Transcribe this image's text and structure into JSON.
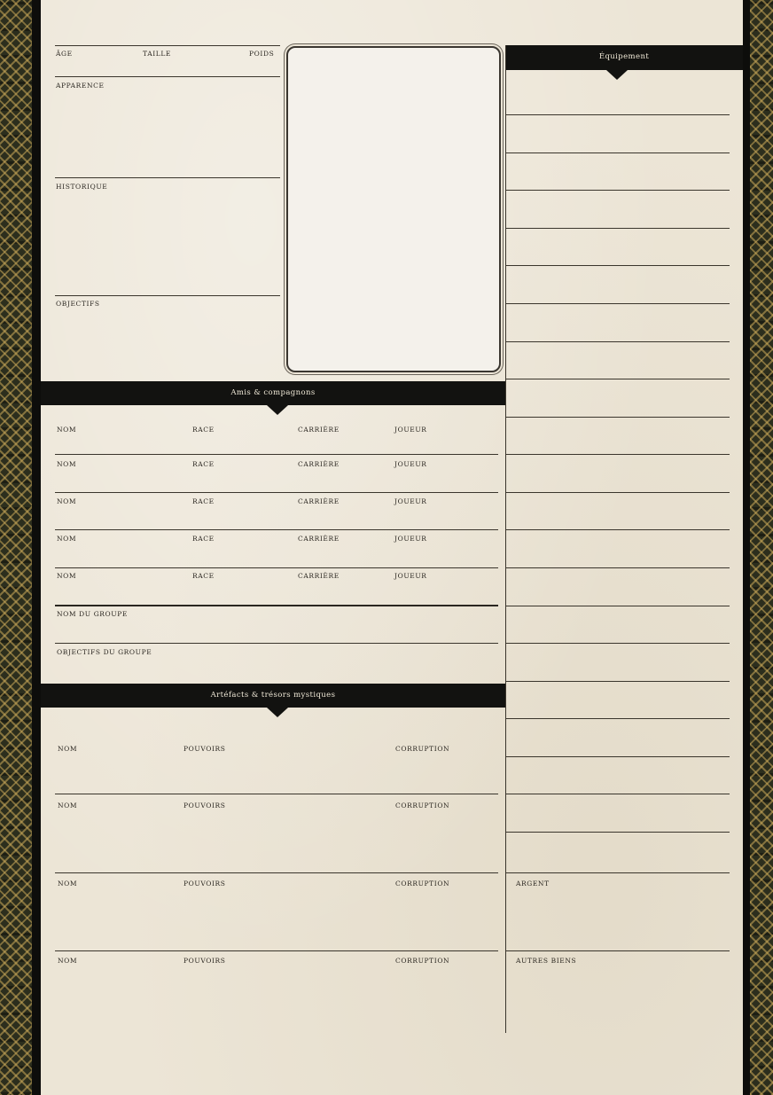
{
  "top_fields": {
    "age": "Âge",
    "taille": "Taille",
    "poids": "Poids",
    "apparence": "Apparence",
    "historique": "Historique",
    "objectifs": "Objectifs"
  },
  "equipement": {
    "title": "Équipement",
    "argent": "Argent",
    "autres_biens": "Autres biens"
  },
  "amis": {
    "title": "Amis & compagnons",
    "col_nom": "Nom",
    "col_race": "Race",
    "col_carriere": "Carrière",
    "col_joueur": "Joueur",
    "nom_groupe": "Nom du groupe",
    "objectifs_groupe": "Objectifs du groupe"
  },
  "artefacts": {
    "title": "Artéfacts & trésors mystiques",
    "col_nom": "Nom",
    "col_pouvoirs": "Pouvoirs",
    "col_corruption": "Corruption"
  }
}
